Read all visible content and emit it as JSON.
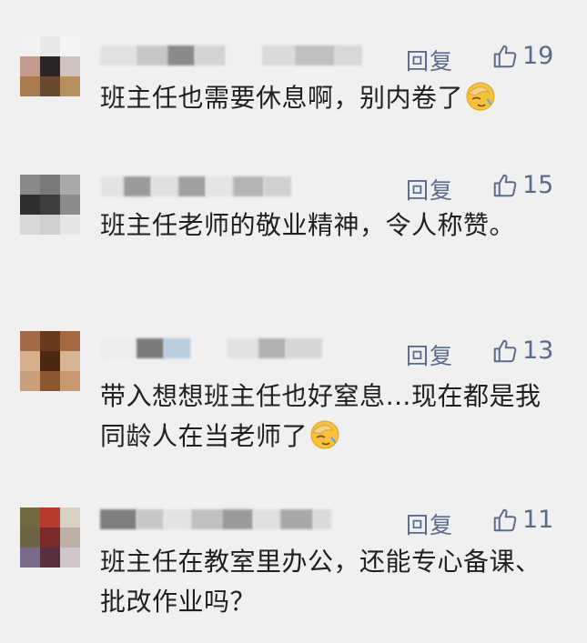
{
  "comments": [
    {
      "reply_label": "回复",
      "like_count": "19",
      "text": "班主任也需要休息啊，别内卷了",
      "has_emoji": true,
      "avatar_colors": [
        "#f2f2f2",
        "#e8e8e8",
        "#f4f4f4",
        "#c49a8e",
        "#2a2426",
        "#cfc4c0",
        "#a87a4e",
        "#6a4a2e",
        "#b8905c"
      ]
    },
    {
      "reply_label": "回复",
      "like_count": "15",
      "text": "班主任老师的敬业精神，令人称赞。",
      "has_emoji": false,
      "avatar_colors": [
        "#8a8a8a",
        "#7a7a7a",
        "#a9a9a9",
        "#2e2e2e",
        "#3e3e3e",
        "#8c8c8c",
        "#d8d8d8",
        "#cfcfcf",
        "#e6e6e6"
      ]
    },
    {
      "reply_label": "回复",
      "like_count": "13",
      "text": "带入想想班主任也好窒息…现在都是我同龄人在当老师了",
      "has_emoji": true,
      "avatar_colors": [
        "#a36a4a",
        "#6a3a1e",
        "#a4693f",
        "#d6b08c",
        "#4a2814",
        "#d7b493",
        "#caa07c",
        "#8c5630",
        "#c89870"
      ]
    },
    {
      "reply_label": "回复",
      "like_count": "11",
      "text": "班主任在教室里办公，还能专心备课、批改作业吗？",
      "has_emoji": false,
      "avatar_colors": [
        "#6e6a3e",
        "#b83a2e",
        "#d8d0c2",
        "#6a6440",
        "#7a2a28",
        "#bcb0a6",
        "#7a6a8a",
        "#5a2e3e",
        "#d0c6cc"
      ]
    }
  ]
}
